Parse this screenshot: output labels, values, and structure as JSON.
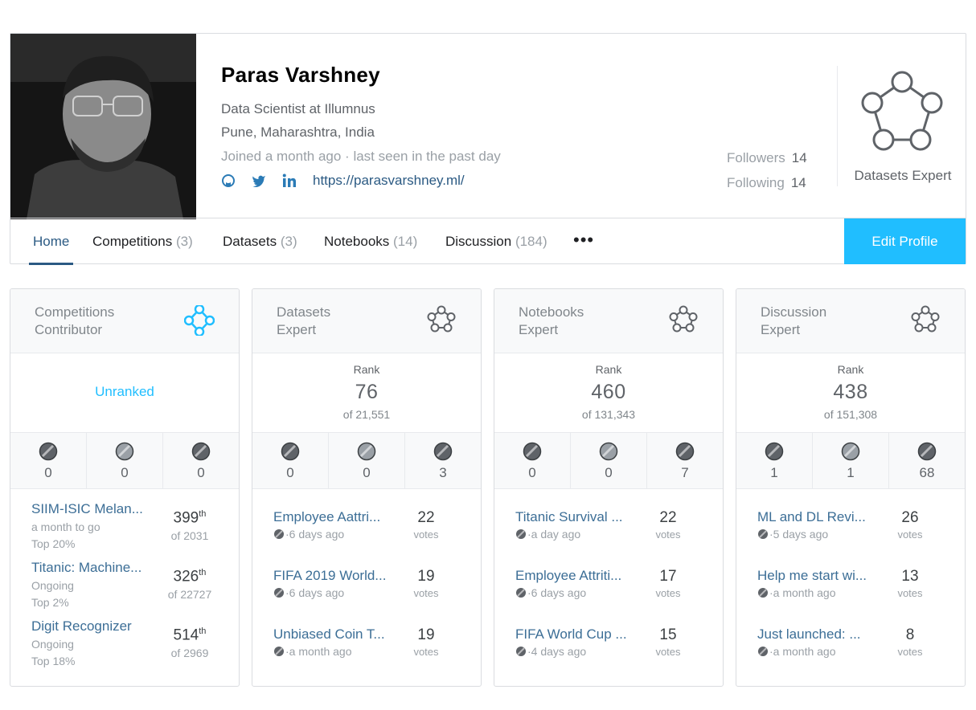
{
  "profile": {
    "name": "Paras Varshney",
    "occupation": "Data Scientist at Illumnus",
    "location": "Pune, Maharashtra, India",
    "joined": "Joined a month ago · last seen in the past day",
    "website": "https://parasvarshney.ml/",
    "followers_label": "Followers",
    "followers_count": "14",
    "following_label": "Following",
    "following_count": "14",
    "tier": "Datasets Expert"
  },
  "tabs": [
    {
      "label": "Home",
      "count": ""
    },
    {
      "label": "Competitions",
      "count": "(3)"
    },
    {
      "label": "Datasets",
      "count": "(3)"
    },
    {
      "label": "Notebooks",
      "count": "(14)"
    },
    {
      "label": "Discussion",
      "count": "(184)"
    }
  ],
  "more_label": "•••",
  "edit_profile": "Edit Profile",
  "cards": [
    {
      "title": [
        "Competitions",
        "Contributor"
      ],
      "unranked": "Unranked",
      "medals": [
        "0",
        "0",
        "0"
      ],
      "items": [
        {
          "title": "SIIM-ISIC Melan...",
          "sub": "a month to go",
          "top": "Top 20%",
          "pos": "399",
          "sup": "th",
          "of": "of 2031"
        },
        {
          "title": "Titanic: Machine...",
          "sub": "Ongoing",
          "top": "Top 2%",
          "pos": "326",
          "sup": "th",
          "of": "of 22727"
        },
        {
          "title": "Digit Recognizer",
          "sub": "Ongoing",
          "top": "Top 18%",
          "pos": "514",
          "sup": "th",
          "of": "of 2969"
        }
      ]
    },
    {
      "title": [
        "Datasets",
        "Expert"
      ],
      "rank_label": "Rank",
      "rank": "76",
      "of": "of 21,551",
      "medals": [
        "0",
        "0",
        "3"
      ],
      "items": [
        {
          "title": "Employee Aattri...",
          "sub": "·6 days ago",
          "votes": "22",
          "votes_label": "votes"
        },
        {
          "title": "FIFA 2019 World...",
          "sub": "·6 days ago",
          "votes": "19",
          "votes_label": "votes"
        },
        {
          "title": "Unbiased Coin T...",
          "sub": "·a month ago",
          "votes": "19",
          "votes_label": "votes"
        }
      ]
    },
    {
      "title": [
        "Notebooks",
        "Expert"
      ],
      "rank_label": "Rank",
      "rank": "460",
      "of": "of 131,343",
      "medals": [
        "0",
        "0",
        "7"
      ],
      "items": [
        {
          "title": "Titanic Survival ...",
          "sub": "·a day ago",
          "votes": "22",
          "votes_label": "votes"
        },
        {
          "title": "Employee Attriti...",
          "sub": "·6 days ago",
          "votes": "17",
          "votes_label": "votes"
        },
        {
          "title": "FIFA World Cup ...",
          "sub": "·4 days ago",
          "votes": "15",
          "votes_label": "votes"
        }
      ]
    },
    {
      "title": [
        "Discussion",
        "Expert"
      ],
      "rank_label": "Rank",
      "rank": "438",
      "of": "of 151,308",
      "medals": [
        "1",
        "1",
        "68"
      ],
      "items": [
        {
          "title": "ML and DL Revi...",
          "sub": "·5 days ago",
          "votes": "26",
          "votes_label": "votes"
        },
        {
          "title": "Help me start wi...",
          "sub": "·a month ago",
          "votes": "13",
          "votes_label": "votes"
        },
        {
          "title": "Just launched: ...",
          "sub": "·a month ago",
          "votes": "8",
          "votes_label": "votes"
        }
      ]
    }
  ],
  "colors": {
    "accent": "#20beff",
    "link": "#2b5a83",
    "gold": "#5f6368",
    "silver": "#9aa0a6",
    "bronze": "#5f6368"
  },
  "icons": [
    "github-icon",
    "twitter-icon",
    "linkedin-icon",
    "pentagon-network-icon",
    "diamond-network-icon",
    "medal-icon",
    "vote-dot-icon"
  ]
}
